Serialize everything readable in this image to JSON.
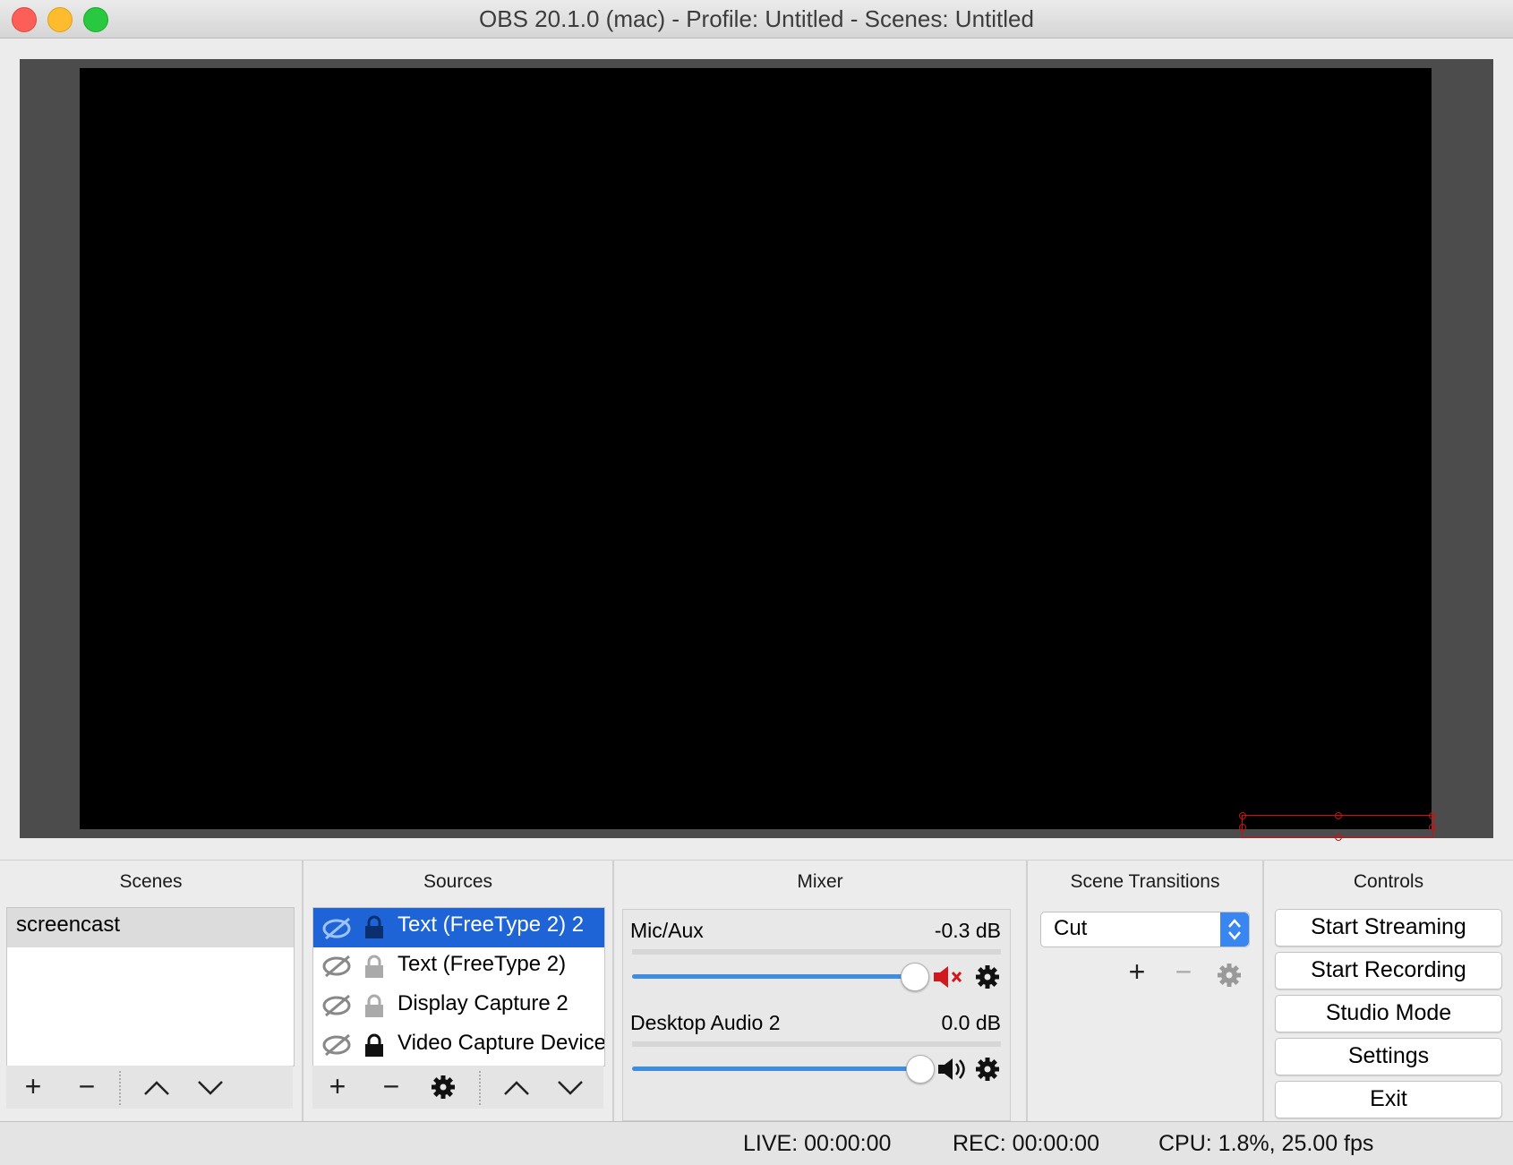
{
  "window": {
    "title": "OBS 20.1.0 (mac) - Profile: Untitled - Scenes: Untitled"
  },
  "scenes": {
    "title": "Scenes",
    "items": [
      "screencast"
    ]
  },
  "sources": {
    "title": "Sources",
    "items": [
      {
        "label": "Text (FreeType 2) 2",
        "visible_icon": "eye-hidden-icon",
        "lock_icon": "lock-icon",
        "selected": true
      },
      {
        "label": "Text (FreeType 2)",
        "visible_icon": "eye-hidden-icon",
        "lock_icon": "unlock-icon",
        "selected": false
      },
      {
        "label": "Display Capture 2",
        "visible_icon": "eye-hidden-icon",
        "lock_icon": "unlock-icon",
        "selected": false
      },
      {
        "label": "Video Capture Device",
        "visible_icon": "eye-hidden-icon",
        "lock_icon": "lock-icon",
        "selected": false
      }
    ]
  },
  "mixer": {
    "title": "Mixer",
    "channels": [
      {
        "name": "Mic/Aux",
        "level": "-0.3 dB",
        "volume_fraction": 0.97,
        "muted": true
      },
      {
        "name": "Desktop Audio 2",
        "level": "0.0 dB",
        "volume_fraction": 1.0,
        "muted": false
      }
    ]
  },
  "transitions": {
    "title": "Scene Transitions",
    "selected": "Cut"
  },
  "controls": {
    "title": "Controls",
    "start_streaming": "Start Streaming",
    "start_recording": "Start Recording",
    "studio_mode": "Studio Mode",
    "settings": "Settings",
    "exit": "Exit"
  },
  "status": {
    "live": "LIVE: 00:00:00",
    "rec": "REC: 00:00:00",
    "cpu": "CPU: 1.8%, 25.00 fps"
  },
  "colors": {
    "selection": "#1e64d6",
    "slider": "#3d8ee0",
    "muted_red": "#d0191c",
    "bounding_box": "#d01010"
  }
}
